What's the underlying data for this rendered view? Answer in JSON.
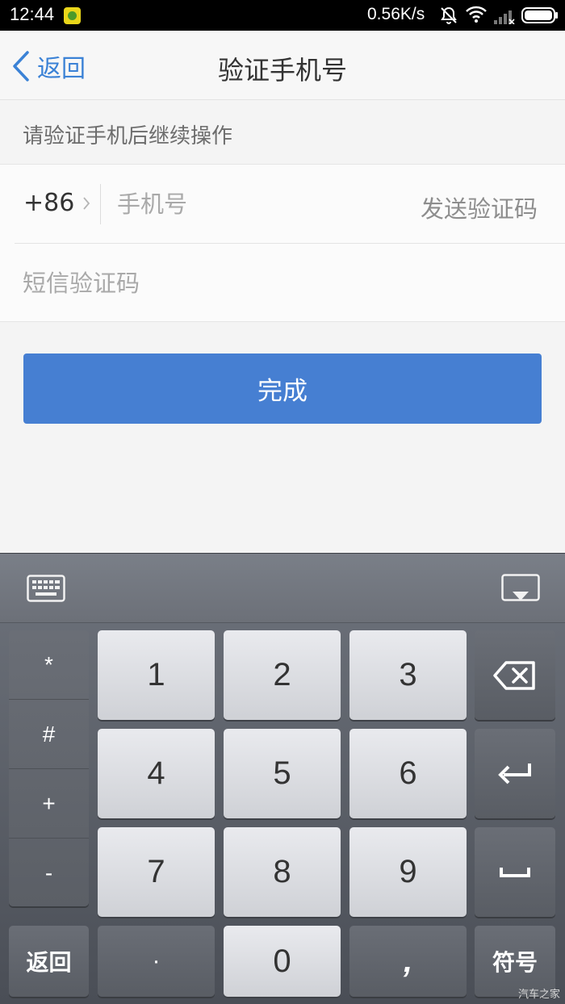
{
  "status_bar": {
    "time": "12:44",
    "speed": "0.56K/s"
  },
  "header": {
    "back_label": "返回",
    "title": "验证手机号"
  },
  "hint": "请验证手机后继续操作",
  "form": {
    "country_code": "+86",
    "phone_placeholder": "手机号",
    "send_code_label": "发送验证码",
    "code_placeholder": "短信验证码"
  },
  "done_label": "完成",
  "keyboard": {
    "symbols": [
      "*",
      "#",
      "+",
      "-"
    ],
    "digits": [
      "1",
      "2",
      "3",
      "4",
      "5",
      "6",
      "7",
      "8",
      "9"
    ],
    "zero": "0",
    "dot": "·",
    "comma": ",",
    "back_label": "返回",
    "symbol_label": "符号"
  },
  "watermark": "汽车之家",
  "colors": {
    "accent": "#467fd2",
    "link": "#3b82d6"
  },
  "icons": [
    "app-notification-icon",
    "bell-muted-icon",
    "wifi-icon",
    "signal-icon",
    "battery-icon",
    "chevron-left-icon",
    "chevron-right-icon",
    "keyboard-icon",
    "keyboard-hide-icon",
    "backspace-icon",
    "enter-icon",
    "space-icon"
  ]
}
